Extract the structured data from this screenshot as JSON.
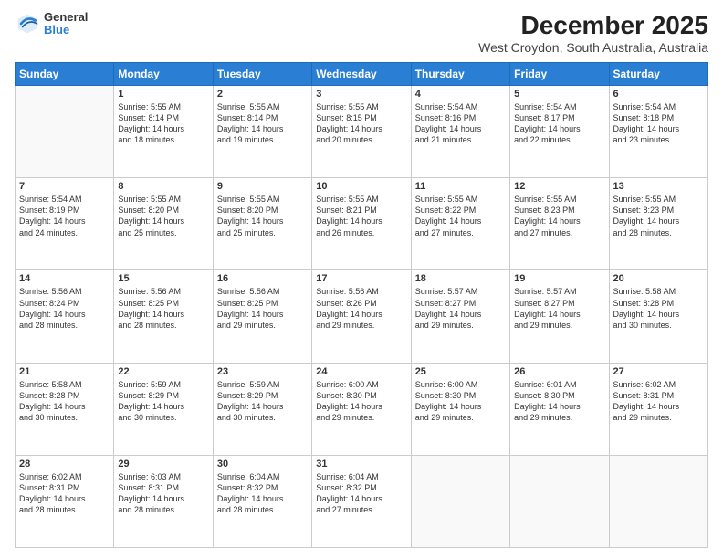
{
  "logo": {
    "general": "General",
    "blue": "Blue"
  },
  "title": "December 2025",
  "subtitle": "West Croydon, South Australia, Australia",
  "days_of_week": [
    "Sunday",
    "Monday",
    "Tuesday",
    "Wednesday",
    "Thursday",
    "Friday",
    "Saturday"
  ],
  "weeks": [
    [
      {
        "day": "",
        "info": ""
      },
      {
        "day": "1",
        "info": "Sunrise: 5:55 AM\nSunset: 8:14 PM\nDaylight: 14 hours\nand 18 minutes."
      },
      {
        "day": "2",
        "info": "Sunrise: 5:55 AM\nSunset: 8:14 PM\nDaylight: 14 hours\nand 19 minutes."
      },
      {
        "day": "3",
        "info": "Sunrise: 5:55 AM\nSunset: 8:15 PM\nDaylight: 14 hours\nand 20 minutes."
      },
      {
        "day": "4",
        "info": "Sunrise: 5:54 AM\nSunset: 8:16 PM\nDaylight: 14 hours\nand 21 minutes."
      },
      {
        "day": "5",
        "info": "Sunrise: 5:54 AM\nSunset: 8:17 PM\nDaylight: 14 hours\nand 22 minutes."
      },
      {
        "day": "6",
        "info": "Sunrise: 5:54 AM\nSunset: 8:18 PM\nDaylight: 14 hours\nand 23 minutes."
      }
    ],
    [
      {
        "day": "7",
        "info": "Sunrise: 5:54 AM\nSunset: 8:19 PM\nDaylight: 14 hours\nand 24 minutes."
      },
      {
        "day": "8",
        "info": "Sunrise: 5:55 AM\nSunset: 8:20 PM\nDaylight: 14 hours\nand 25 minutes."
      },
      {
        "day": "9",
        "info": "Sunrise: 5:55 AM\nSunset: 8:20 PM\nDaylight: 14 hours\nand 25 minutes."
      },
      {
        "day": "10",
        "info": "Sunrise: 5:55 AM\nSunset: 8:21 PM\nDaylight: 14 hours\nand 26 minutes."
      },
      {
        "day": "11",
        "info": "Sunrise: 5:55 AM\nSunset: 8:22 PM\nDaylight: 14 hours\nand 27 minutes."
      },
      {
        "day": "12",
        "info": "Sunrise: 5:55 AM\nSunset: 8:23 PM\nDaylight: 14 hours\nand 27 minutes."
      },
      {
        "day": "13",
        "info": "Sunrise: 5:55 AM\nSunset: 8:23 PM\nDaylight: 14 hours\nand 28 minutes."
      }
    ],
    [
      {
        "day": "14",
        "info": "Sunrise: 5:56 AM\nSunset: 8:24 PM\nDaylight: 14 hours\nand 28 minutes."
      },
      {
        "day": "15",
        "info": "Sunrise: 5:56 AM\nSunset: 8:25 PM\nDaylight: 14 hours\nand 28 minutes."
      },
      {
        "day": "16",
        "info": "Sunrise: 5:56 AM\nSunset: 8:25 PM\nDaylight: 14 hours\nand 29 minutes."
      },
      {
        "day": "17",
        "info": "Sunrise: 5:56 AM\nSunset: 8:26 PM\nDaylight: 14 hours\nand 29 minutes."
      },
      {
        "day": "18",
        "info": "Sunrise: 5:57 AM\nSunset: 8:27 PM\nDaylight: 14 hours\nand 29 minutes."
      },
      {
        "day": "19",
        "info": "Sunrise: 5:57 AM\nSunset: 8:27 PM\nDaylight: 14 hours\nand 29 minutes."
      },
      {
        "day": "20",
        "info": "Sunrise: 5:58 AM\nSunset: 8:28 PM\nDaylight: 14 hours\nand 30 minutes."
      }
    ],
    [
      {
        "day": "21",
        "info": "Sunrise: 5:58 AM\nSunset: 8:28 PM\nDaylight: 14 hours\nand 30 minutes."
      },
      {
        "day": "22",
        "info": "Sunrise: 5:59 AM\nSunset: 8:29 PM\nDaylight: 14 hours\nand 30 minutes."
      },
      {
        "day": "23",
        "info": "Sunrise: 5:59 AM\nSunset: 8:29 PM\nDaylight: 14 hours\nand 30 minutes."
      },
      {
        "day": "24",
        "info": "Sunrise: 6:00 AM\nSunset: 8:30 PM\nDaylight: 14 hours\nand 29 minutes."
      },
      {
        "day": "25",
        "info": "Sunrise: 6:00 AM\nSunset: 8:30 PM\nDaylight: 14 hours\nand 29 minutes."
      },
      {
        "day": "26",
        "info": "Sunrise: 6:01 AM\nSunset: 8:30 PM\nDaylight: 14 hours\nand 29 minutes."
      },
      {
        "day": "27",
        "info": "Sunrise: 6:02 AM\nSunset: 8:31 PM\nDaylight: 14 hours\nand 29 minutes."
      }
    ],
    [
      {
        "day": "28",
        "info": "Sunrise: 6:02 AM\nSunset: 8:31 PM\nDaylight: 14 hours\nand 28 minutes."
      },
      {
        "day": "29",
        "info": "Sunrise: 6:03 AM\nSunset: 8:31 PM\nDaylight: 14 hours\nand 28 minutes."
      },
      {
        "day": "30",
        "info": "Sunrise: 6:04 AM\nSunset: 8:32 PM\nDaylight: 14 hours\nand 28 minutes."
      },
      {
        "day": "31",
        "info": "Sunrise: 6:04 AM\nSunset: 8:32 PM\nDaylight: 14 hours\nand 27 minutes."
      },
      {
        "day": "",
        "info": ""
      },
      {
        "day": "",
        "info": ""
      },
      {
        "day": "",
        "info": ""
      }
    ]
  ]
}
